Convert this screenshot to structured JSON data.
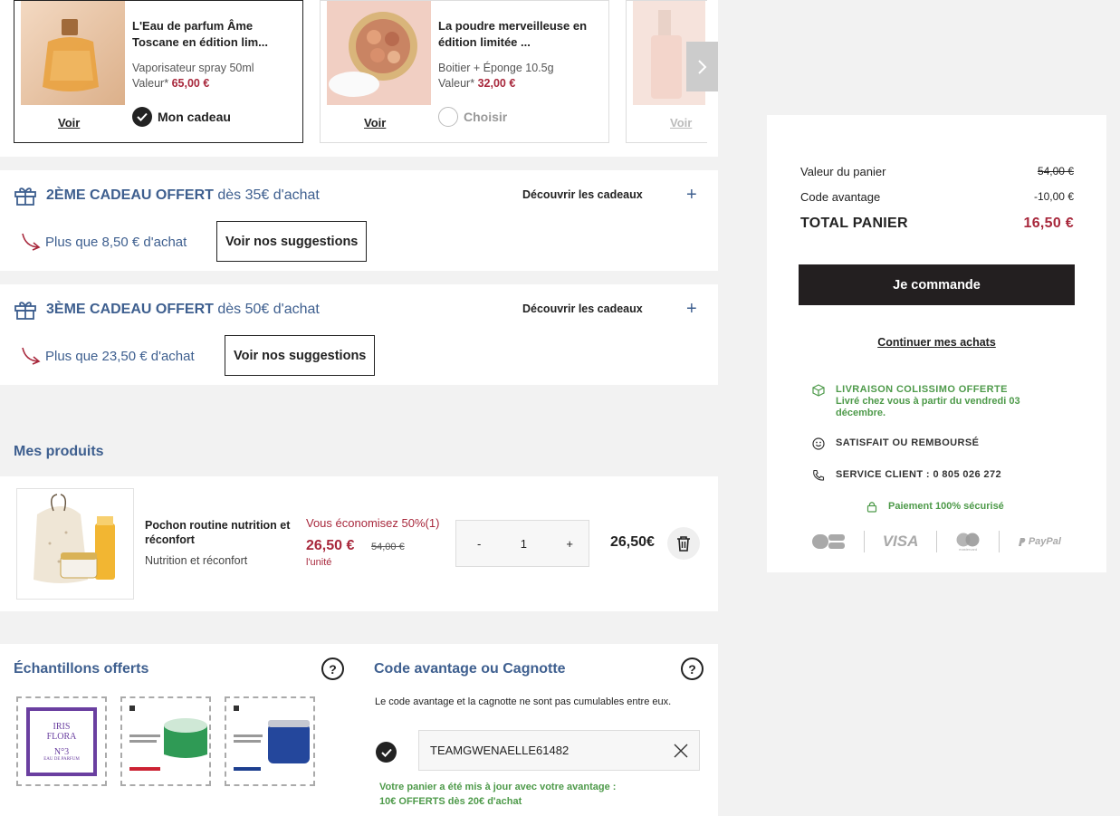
{
  "gifts": [
    {
      "title": "L'Eau de parfum Âme Toscane en édition lim...",
      "detail": "Vaporisateur spray 50ml",
      "value_label": "Valeur*",
      "value": "65,00 €",
      "link": "Voir",
      "choice": "Mon cadeau",
      "selected": true
    },
    {
      "title": "La poudre merveilleuse en édition limitée ...",
      "detail": "Boitier + Éponge 10.5g",
      "value_label": "Valeur*",
      "value": "32,00 €",
      "link": "Voir",
      "choice": "Choisir",
      "selected": false
    },
    {
      "link": "Voir"
    }
  ],
  "tiers": [
    {
      "title_bold": "2ÈME CADEAU OFFERT",
      "title_rest": "dès 35€ d'achat",
      "discover": "Découvrir les cadeaux",
      "remaining": "Plus que 8,50 € d'achat",
      "button": "Voir nos suggestions"
    },
    {
      "title_bold": "3ÈME CADEAU OFFERT",
      "title_rest": "dès 50€ d'achat",
      "discover": "Découvrir les cadeaux",
      "remaining": "Plus que 23,50 € d'achat",
      "button": "Voir nos suggestions"
    }
  ],
  "products": {
    "title": "Mes produits",
    "item": {
      "name": "Pochon routine nutrition et réconfort",
      "subtitle": "Nutrition et réconfort",
      "savings": "Vous économisez 50%(1)",
      "price": "26,50 €",
      "old_price": "54,00 €",
      "unit": "l'unité",
      "qty_minus": "-",
      "qty": "1",
      "qty_plus": "+",
      "total": "26,50€"
    }
  },
  "samples": {
    "title": "Échantillons offerts",
    "help": "?",
    "iris_line1": "IRIS",
    "iris_line2": "FLORA",
    "iris_number": "N°3",
    "iris_sub": "EAU DE PARFUM"
  },
  "code": {
    "title": "Code avantage ou Cagnotte",
    "help": "?",
    "note": "Le code avantage et la cagnotte ne sont pas cumulables entre eux.",
    "value": "TEAMGWENAELLE61482",
    "success_line1": "Votre panier a été mis à jour avec votre avantage :",
    "success_line2": "10€ OFFERTS dès 20€ d'achat"
  },
  "summary": {
    "basket_label": "Valeur du panier",
    "basket_value": "54,00 €",
    "code_label": "Code avantage",
    "code_value": "-10,00 €",
    "total_label": "TOTAL PANIER",
    "total_value": "16,50 €",
    "order_button": "Je commande",
    "continue": "Continuer mes achats",
    "shipping_title": "LIVRAISON COLISSIMO OFFERTE",
    "shipping_detail": "Livré chez vous à partir du vendredi 03 décembre.",
    "satisfied": "SATISFAIT OU REMBOURSÉ",
    "service": "SERVICE CLIENT : 0 805 026 272",
    "secure": "Paiement 100% sécurisé",
    "payments": [
      "CB",
      "VISA",
      "mastercard",
      "PayPal"
    ]
  },
  "colors": {
    "accent_blue": "#3e5f8f",
    "price_red": "#a8283c",
    "success_green": "#4e9a4a",
    "dark": "#231f20"
  }
}
